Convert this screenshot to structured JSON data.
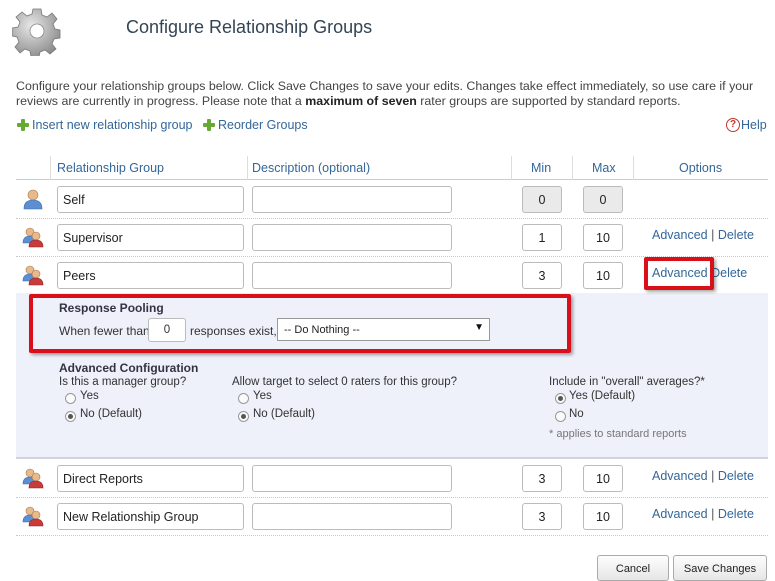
{
  "page": {
    "title": "Configure Relationship Groups",
    "intro_part1": "Configure your relationship groups below. Click Save Changes to save your edits. Changes take effect immediately, so use care if your reviews are currently in progress. Please note that a ",
    "intro_bold": "maximum of seven",
    "intro_part2": " rater groups are supported by standard reports."
  },
  "actions": {
    "insert_label": "Insert new relationship group",
    "reorder_label": "Reorder Groups",
    "help_label": "Help"
  },
  "table": {
    "headers": {
      "group": "Relationship Group",
      "description": "Description (optional)",
      "min": "Min",
      "max": "Max",
      "options": "Options"
    },
    "rows": [
      {
        "name": "Self",
        "description": "",
        "min": "0",
        "max": "0",
        "advanced": "",
        "delete": "",
        "sep": ""
      },
      {
        "name": "Supervisor",
        "description": "",
        "min": "1",
        "max": "10",
        "advanced": "Advanced",
        "delete": "Delete",
        "sep": "|"
      },
      {
        "name": "Peers",
        "description": "",
        "min": "3",
        "max": "10",
        "advanced": "Advanced",
        "delete": "Delete",
        "sep": ""
      },
      {
        "name": "Direct Reports",
        "description": "",
        "min": "3",
        "max": "10",
        "advanced": "Advanced",
        "delete": "Delete",
        "sep": "|"
      },
      {
        "name": "New Relationship Group",
        "description": "",
        "min": "3",
        "max": "10",
        "advanced": "Advanced",
        "delete": "Delete",
        "sep": "|"
      }
    ]
  },
  "advanced_panel": {
    "pooling_title": "Response Pooling",
    "pooling_prefix": "When fewer than",
    "pooling_value": "0",
    "pooling_suffix": "responses exist,",
    "pooling_select": "-- Do Nothing --",
    "config_title": "Advanced Configuration",
    "manager_q": "Is this a manager group?",
    "manager_yes": "Yes",
    "manager_no": "No (Default)",
    "zero_q": "Allow target to select 0 raters for this group?",
    "zero_yes": "Yes",
    "zero_no": "No (Default)",
    "overall_q": "Include in \"overall\" averages?*",
    "overall_yes": "Yes (Default)",
    "overall_no": "No",
    "footnote": "* applies to standard reports"
  },
  "buttons": {
    "cancel": "Cancel",
    "save": "Save Changes"
  },
  "colors": {
    "link": "#336699",
    "highlight": "#d9101a",
    "panel_bg": "#eef0fa",
    "plus_icon": "#66aa33"
  }
}
